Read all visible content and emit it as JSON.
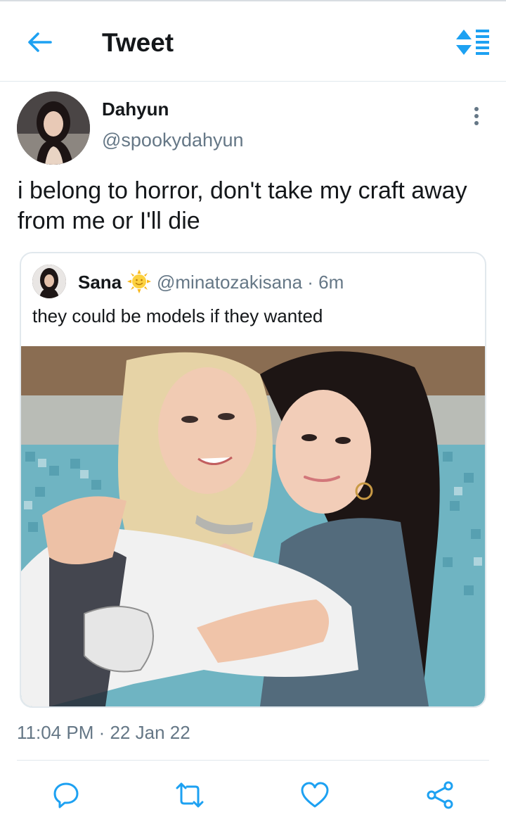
{
  "header": {
    "title": "Tweet",
    "back_icon": "back-arrow-icon",
    "sort_icon": "sort-icon",
    "accent_color": "#1da1f2"
  },
  "tweet": {
    "author_name": "Dahyun",
    "author_handle": "@spookydahyun",
    "text": "i belong to horror, don't take my craft away from me or I'll die",
    "timestamp": "11:04 PM · 22 Jan 22"
  },
  "quoted_tweet": {
    "author_name": "Sana",
    "emoji": "sun-with-face",
    "handle_time": "@minatozakisana · 6m",
    "text": "they could be models if they wanted"
  },
  "actions": {
    "reply_icon": "reply-icon",
    "retweet_icon": "retweet-icon",
    "like_icon": "heart-icon",
    "share_icon": "share-icon",
    "icon_color": "#1da1f2"
  }
}
